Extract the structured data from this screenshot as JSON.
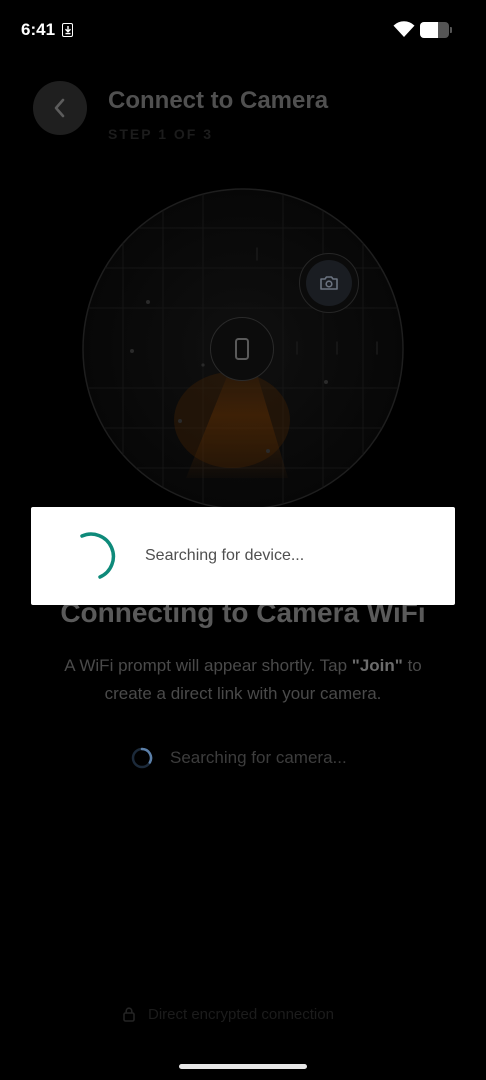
{
  "status_bar": {
    "time": "6:41",
    "icons": [
      "download-notification-icon",
      "wifi-icon",
      "battery-icon"
    ],
    "battery_level": 0.62
  },
  "header": {
    "back_icon": "chevron-left-icon",
    "title": "Connect to Camera",
    "step": "STEP 1 OF 3"
  },
  "radar": {
    "phone_icon": "smartphone-icon",
    "camera_icon": "camera-icon",
    "beam_color": "#6a3506"
  },
  "main": {
    "heading": "Connecting to Camera WiFi",
    "description_before": "A WiFi prompt will appear shortly. Tap ",
    "description_emphasis": "\"Join\"",
    "description_after": " to create a direct link with your camera.",
    "search_status": "Searching for camera...",
    "search_spinner_color": "#5b7fa8"
  },
  "footer": {
    "lock_icon": "lock-icon",
    "note": "Direct encrypted connection"
  },
  "dialog": {
    "message": "Searching for device...",
    "spinner_color": "#0e8a7a"
  }
}
